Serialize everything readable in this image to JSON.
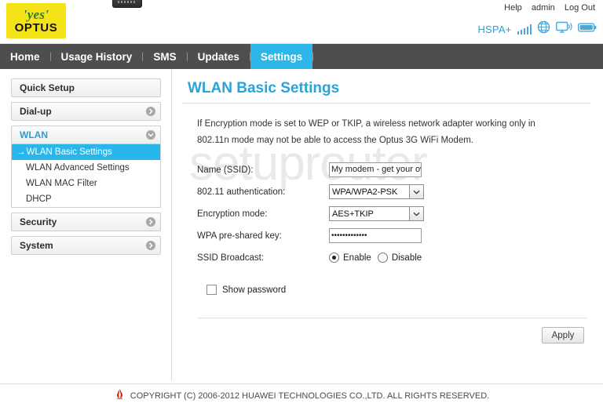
{
  "brand": {
    "logo_yes": "'yes'",
    "logo_optus": "OPTUS",
    "device_icon": "modem-device-icon"
  },
  "header": {
    "links": [
      {
        "label": "Help",
        "name": "help-link"
      },
      {
        "label": "admin",
        "name": "admin-link"
      },
      {
        "label": "Log Out",
        "name": "logout-link"
      }
    ],
    "status": {
      "network_type": "HSPA+",
      "signal_icon": "signal-bars-icon",
      "globe_icon": "globe-icon",
      "monitor_icon": "monitor-signal-icon",
      "battery_icon": "battery-icon",
      "accent_color": "#4aa8d8"
    }
  },
  "nav": {
    "items": [
      {
        "label": "Home",
        "active": false
      },
      {
        "label": "Usage History",
        "active": false
      },
      {
        "label": "SMS",
        "active": false
      },
      {
        "label": "Updates",
        "active": false
      },
      {
        "label": "Settings",
        "active": true
      }
    ],
    "active_color": "#2cb6ea",
    "bar_color": "#4e4e4e"
  },
  "sidebar": {
    "groups": [
      {
        "label": "Quick Setup",
        "has_arrow": false,
        "open": false
      },
      {
        "label": "Dial-up",
        "has_arrow": true,
        "open": false
      },
      {
        "label": "WLAN",
        "has_arrow": true,
        "open": true,
        "items": [
          {
            "label": "WLAN Basic Settings",
            "active": true,
            "prefix": "→"
          },
          {
            "label": "WLAN Advanced Settings",
            "active": false
          },
          {
            "label": "WLAN MAC Filter",
            "active": false
          },
          {
            "label": "DHCP",
            "active": false
          }
        ]
      },
      {
        "label": "Security",
        "has_arrow": true,
        "open": false
      },
      {
        "label": "System",
        "has_arrow": true,
        "open": false
      }
    ]
  },
  "content": {
    "title": "WLAN Basic Settings",
    "title_color": "#29a3d9",
    "notice": "If Encryption mode is set to WEP or TKIP, a wireless network adapter working only in 802.11n mode may not be able to access the Optus 3G WiFi Modem.",
    "watermark": "setuprouter",
    "fields": [
      {
        "label": "Name (SSID):",
        "type": "text",
        "value": "My modem - get your own",
        "name": "ssid-input"
      },
      {
        "label": "802.11 authentication:",
        "type": "select",
        "value": "WPA/WPA2-PSK",
        "name": "authentication-select"
      },
      {
        "label": "Encryption mode:",
        "type": "select",
        "value": "AES+TKIP",
        "name": "encryption-mode-select"
      },
      {
        "label": "WPA pre-shared key:",
        "type": "password",
        "value": "•••••••••••••",
        "name": "wpa-key-input"
      }
    ],
    "ssid_broadcast": {
      "label": "SSID Broadcast:",
      "options": [
        {
          "label": "Enable",
          "selected": true
        },
        {
          "label": "Disable",
          "selected": false
        }
      ]
    },
    "show_password": {
      "label": "Show password",
      "checked": false
    },
    "apply_label": "Apply"
  },
  "footer": {
    "copyright": "COPYRIGHT (C) 2006-2012 HUAWEI TECHNOLOGIES CO.,LTD. ALL RIGHTS RESERVED.",
    "logo_icon": "huawei-logo-icon",
    "logo_color": "#d81e06"
  }
}
